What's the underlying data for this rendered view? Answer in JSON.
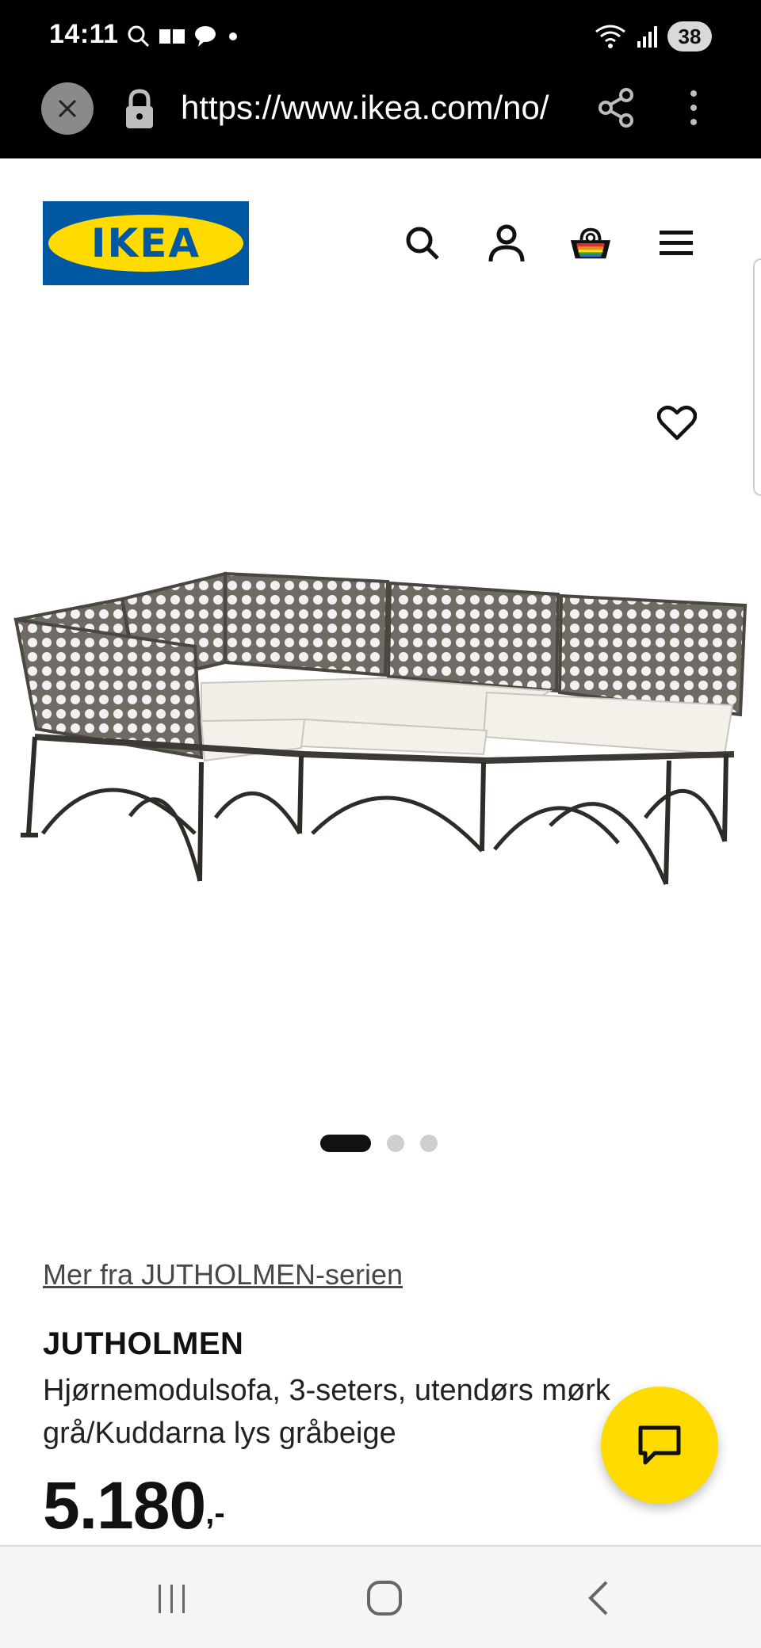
{
  "status_bar": {
    "time": "14:11",
    "battery": "38",
    "notification_icons": [
      "search-icon",
      "messages-icon",
      "chat-bubble-icon",
      "dot-icon"
    ],
    "system_icons": [
      "wifi-icon",
      "signal-icon",
      "battery-icon"
    ]
  },
  "browser": {
    "url": "https://www.ikea.com/no/"
  },
  "header": {
    "logo_text": "IKEA",
    "icons": [
      "search-icon",
      "account-icon",
      "cart-icon",
      "menu-icon"
    ]
  },
  "product": {
    "series_link": "Mer fra JUTHOLMEN-serien",
    "name": "JUTHOLMEN",
    "description": "Hjørnemodulsofa, 3-seters, utendørs mørk grå/Kuddarna lys gråbeige",
    "price": "5.180",
    "price_suffix": ",-",
    "image_count": 3,
    "active_image": 1
  },
  "colors": {
    "ikea_blue": "#0058a3",
    "ikea_yellow": "#ffdb00",
    "status_bg": "#000000"
  }
}
